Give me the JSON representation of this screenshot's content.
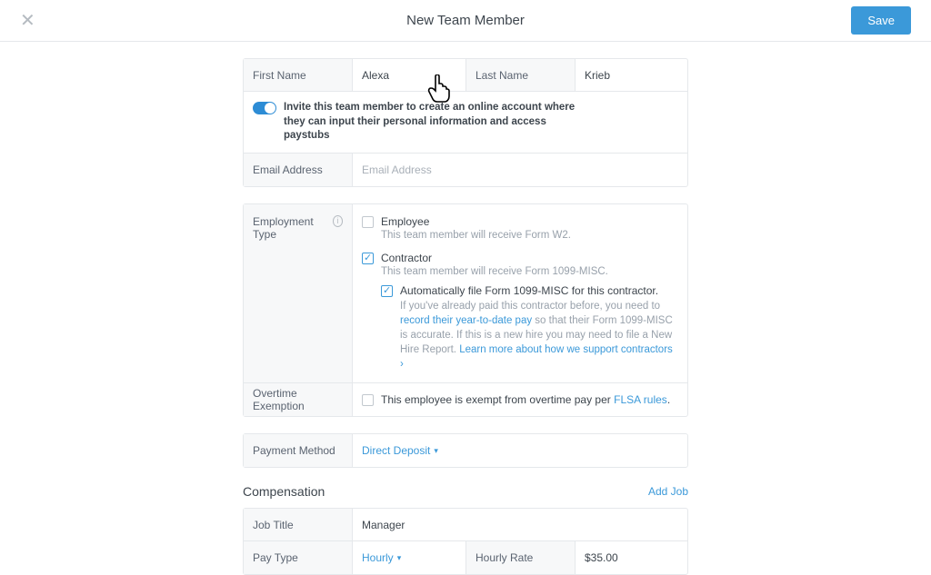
{
  "header": {
    "title": "New Team Member",
    "save": "Save"
  },
  "name": {
    "first_label": "First Name",
    "first_value": "Alexa",
    "last_label": "Last Name",
    "last_value": "Krieb"
  },
  "invite": {
    "text": "Invite this team member to create an online account where they can input their personal information and access paystubs"
  },
  "email": {
    "label": "Email Address",
    "placeholder": "Email Address"
  },
  "employment": {
    "label": "Employment Type",
    "employee_label": "Employee",
    "employee_sub": "This team member will receive Form W2.",
    "contractor_label": "Contractor",
    "contractor_sub": "This team member will receive Form 1099-MISC.",
    "auto_file_label": "Automatically file Form 1099-MISC for this contractor.",
    "auto_file_sub1": "If you've already paid this contractor before, you need to ",
    "auto_file_link1": "record their year-to-date pay",
    "auto_file_sub2": " so that their Form 1099-MISC is accurate. If this is a new hire you may need to file a New Hire Report. ",
    "auto_file_link2": "Learn more about how we support contractors ›"
  },
  "overtime": {
    "label": "Overtime Exemption",
    "text": "This employee is exempt from overtime pay per ",
    "link": "FLSA rules",
    "period": "."
  },
  "payment": {
    "label": "Payment Method",
    "value": "Direct Deposit"
  },
  "compensation": {
    "title": "Compensation",
    "add_job": "Add Job",
    "job_title_label": "Job Title",
    "job_title_value": "Manager",
    "pay_type_label": "Pay Type",
    "pay_type_value": "Hourly",
    "hourly_rate_label": "Hourly Rate",
    "hourly_rate_value": "$35.00"
  }
}
